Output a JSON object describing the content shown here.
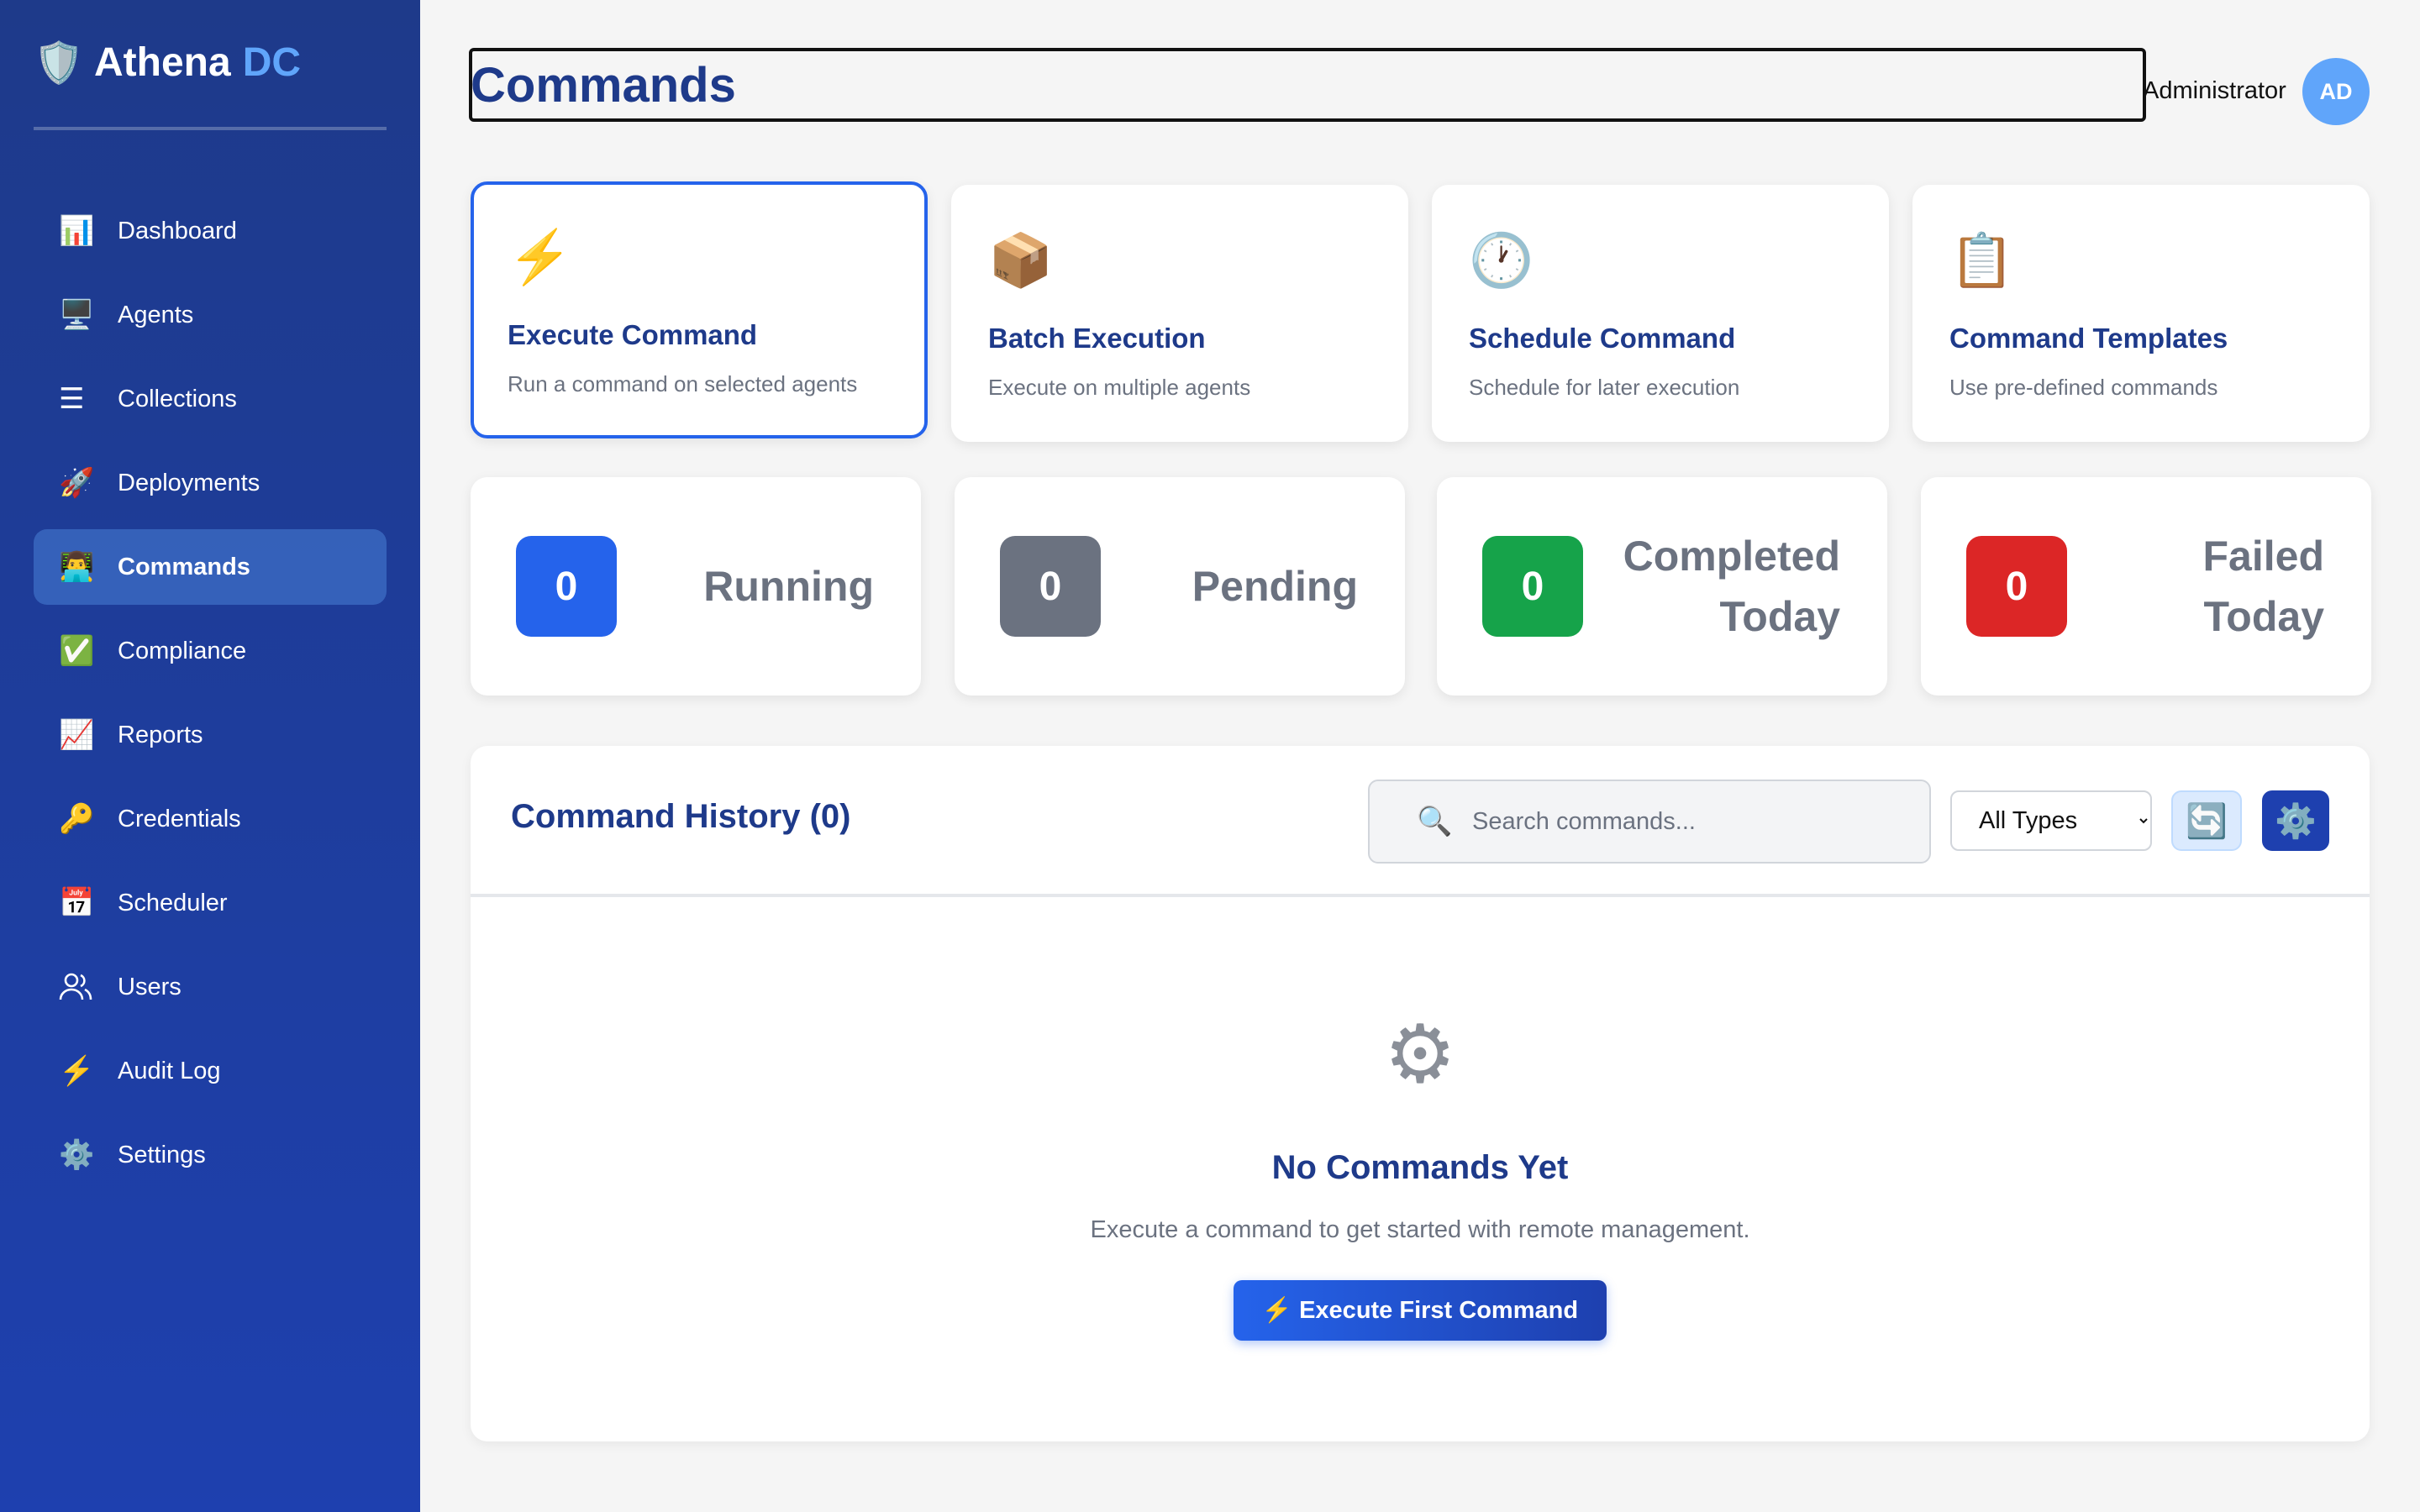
{
  "brand": {
    "shield_icon": "🛡️",
    "name": "Athena",
    "accent": "DC"
  },
  "sidebar": {
    "items": [
      {
        "icon": "📊",
        "label": "Dashboard"
      },
      {
        "icon": "🖥️",
        "label": "Agents"
      },
      {
        "icon": "☰",
        "label": "Collections"
      },
      {
        "icon": "🚀",
        "label": "Deployments"
      },
      {
        "icon": "👨‍💻",
        "label": "Commands"
      },
      {
        "icon": "✅",
        "label": "Compliance"
      },
      {
        "icon": "📈",
        "label": "Reports"
      },
      {
        "icon": "🔑",
        "label": "Credentials"
      },
      {
        "icon": "📅",
        "label": "Scheduler"
      },
      {
        "icon": "users-outline",
        "label": "Users"
      },
      {
        "icon": "⚡",
        "label": "Audit Log"
      },
      {
        "icon": "⚙️",
        "label": "Settings"
      }
    ],
    "active": "Commands"
  },
  "header": {
    "title": "Commands",
    "user": "Administrator",
    "avatar_initials": "AD"
  },
  "actions": [
    {
      "icon": "⚡",
      "title": "Execute Command",
      "desc": "Run a command on selected agents"
    },
    {
      "icon": "📦",
      "title": "Batch Execution",
      "desc": "Execute on multiple agents"
    },
    {
      "icon": "🕐",
      "title": "Schedule Command",
      "desc": "Schedule for later execution"
    },
    {
      "icon": "📋",
      "title": "Command Templates",
      "desc": "Use pre-defined commands"
    }
  ],
  "stats": [
    {
      "value": "0",
      "label": "Running",
      "color": "#2563eb"
    },
    {
      "value": "0",
      "label": "Pending",
      "color": "#6b7280"
    },
    {
      "value": "0",
      "label": "Completed Today",
      "color": "#16a34a"
    },
    {
      "value": "0",
      "label": "Failed Today",
      "color": "#dc2626"
    }
  ],
  "history": {
    "title": "Command History (0)",
    "search_icon": "🔍",
    "search_placeholder": "Search commands...",
    "filter_selected": "All Types",
    "refresh_icon": "🔄",
    "settings_icon": "⚙️",
    "empty_icon": "⚙",
    "empty_title": "No Commands Yet",
    "empty_desc": "Execute a command to get started with remote management.",
    "cta_label": "⚡ Execute First Command"
  },
  "colors": {
    "sidebar": "#1e3a8a",
    "accent": "#60a5fa",
    "primary": "#2563eb",
    "title": "#1e3a8a"
  }
}
